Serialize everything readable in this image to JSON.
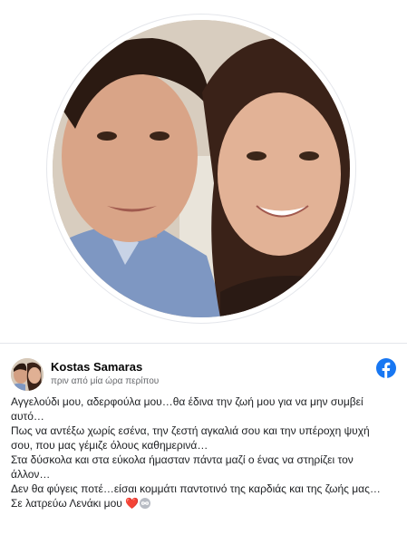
{
  "post": {
    "author": "Kostas Samaras",
    "timestamp": "πριν από μία ώρα περίπου",
    "lines": [
      "Αγγελούδι μου, αδερφούλα μου…θα έδινα την ζωή μου για να μην συμβεί αυτό…",
      "Πως να αντέξω χωρίς εσένα, την ζεστή αγκαλιά σου και την υπέροχη ψυχή σου, που μας γέμιζε όλους καθημερινά…",
      "Στα δύσκολα και στα εύκολα ήμασταν πάντα μαζί ο ένας να στηρίζει τον άλλον…",
      "Δεν θα φύγεις ποτέ…είσαι κομμάτι παντοτινό της καρδιάς και της ζωής μας…Σε λατρεύω Λενάκι μου"
    ],
    "heart_emoji": "❤️"
  },
  "icons": {
    "platform": "facebook-icon",
    "infinity": "infinity-icon",
    "brand_color": "#1877f2"
  }
}
